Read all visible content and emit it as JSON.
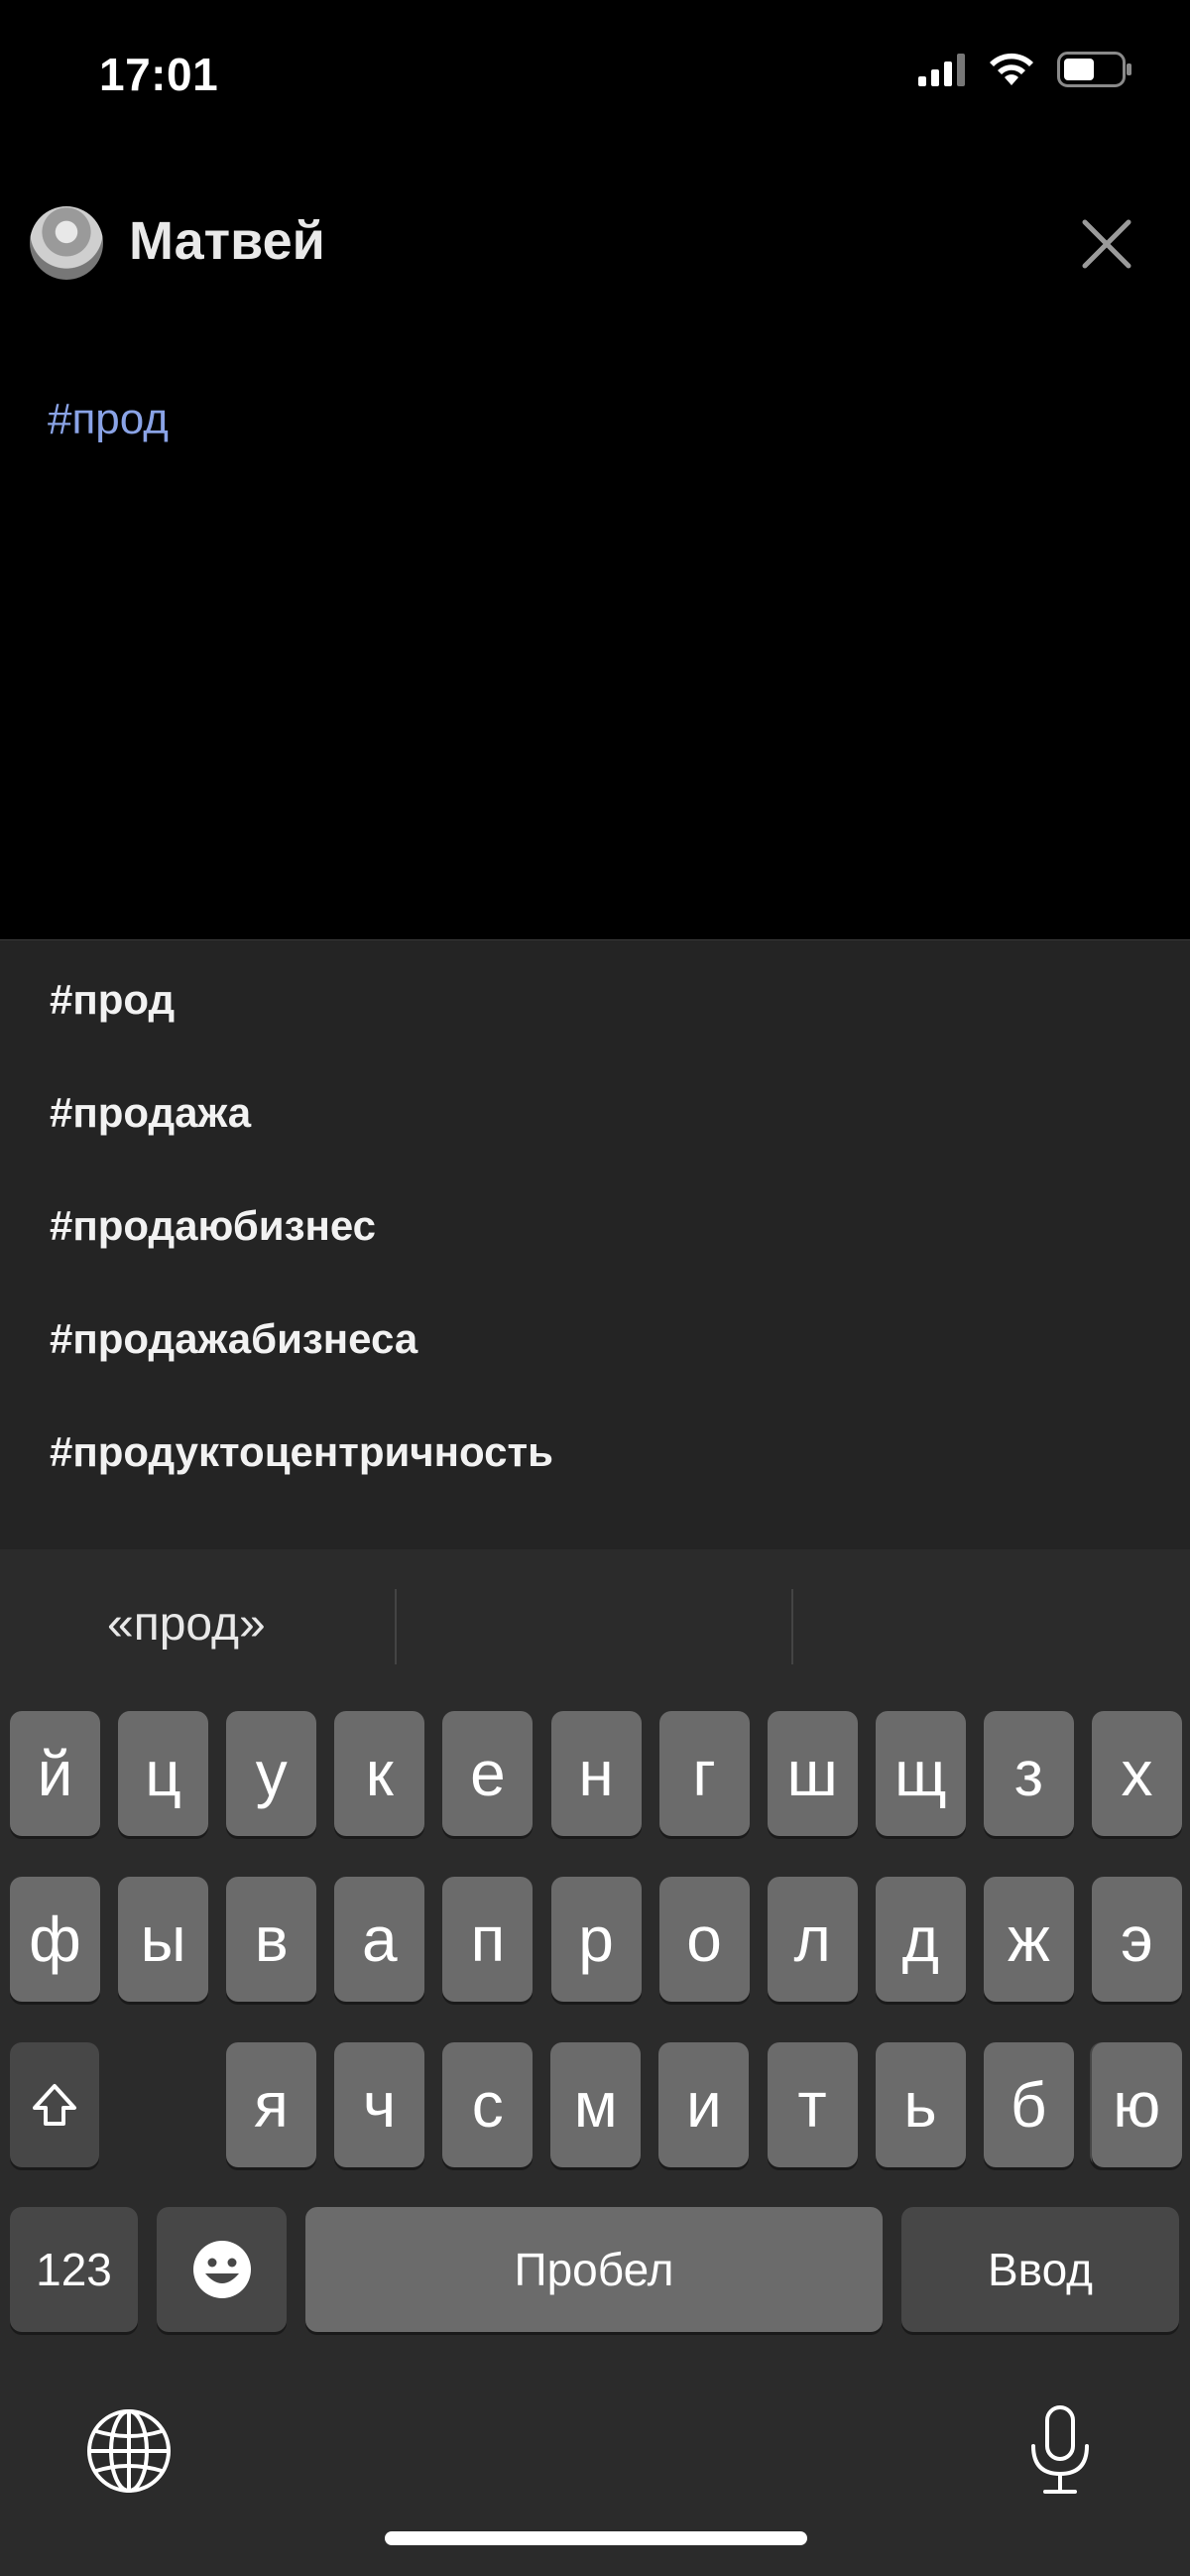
{
  "status_bar": {
    "time": "17:01"
  },
  "header": {
    "author_name": "Матвей"
  },
  "editor": {
    "text": "#прод"
  },
  "suggestions": [
    "#прод",
    "#продажа",
    "#продаюбизнес",
    "#продажабизнеса",
    "#продуктоцентричность"
  ],
  "keyboard": {
    "predictions": [
      "«прод»",
      "",
      ""
    ],
    "row1": [
      "й",
      "ц",
      "у",
      "к",
      "е",
      "н",
      "г",
      "ш",
      "щ",
      "з",
      "х"
    ],
    "row2": [
      "ф",
      "ы",
      "в",
      "а",
      "п",
      "р",
      "о",
      "л",
      "д",
      "ж",
      "э"
    ],
    "row3": [
      "я",
      "ч",
      "с",
      "м",
      "и",
      "т",
      "ь",
      "б",
      "ю"
    ],
    "numbers_label": "123",
    "space_label": "Пробел",
    "return_label": "Ввод"
  },
  "colors": {
    "hashtag": "#8aa3e6",
    "panel": "#242424",
    "keyboard": "#2b2b2b"
  }
}
